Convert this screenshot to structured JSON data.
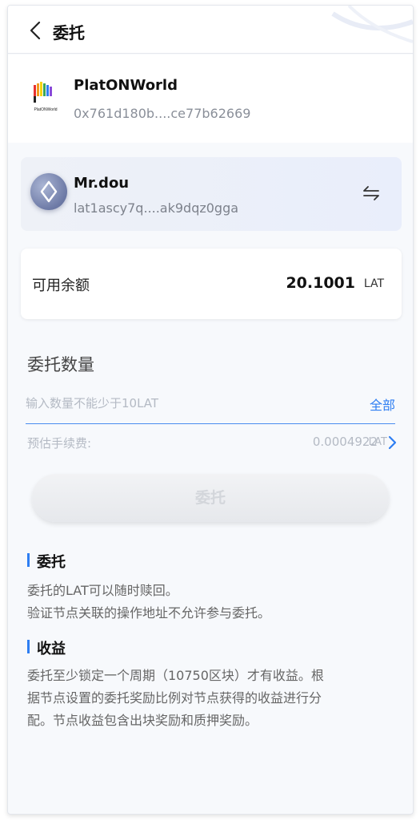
{
  "header": {
    "title": "委托",
    "back_icon": "chevron-left-icon"
  },
  "node": {
    "logo_text": "PlatONWorld",
    "name": "PlatONWorld",
    "address": "0x761d180b....ce77b62669"
  },
  "wallet": {
    "name": "Mr.dou",
    "address": "lat1ascy7q....ak9dqz0gga",
    "avatar_icon": "diamond-icon",
    "switch_icon": "swap-arrows-icon"
  },
  "balance": {
    "label": "可用余额",
    "value": "20.1001",
    "unit": "LAT"
  },
  "amount": {
    "title": "委托数量",
    "placeholder": "输入数量不能少于10LAT",
    "value": "",
    "all_label": "全部"
  },
  "fee": {
    "label": "预估手续费:",
    "value": "0.0004922",
    "unit": "LAT"
  },
  "delegate_button": {
    "label": "委托"
  },
  "info": {
    "delegation_heading": "委托",
    "delegation_lines": [
      "委托的LAT可以随时赎回。",
      "验证节点关联的操作地址不允许参与委托。"
    ],
    "earnings_heading": "收益",
    "earnings_lines": [
      "委托至少锁定一个周期（10750区块）才有收益。根",
      "据节点设置的委托奖励比例对节点获得的收益进行分",
      "配。节点收益包含出块奖励和质押奖励。"
    ]
  },
  "colors": {
    "accent": "#2e7ef2",
    "page_bg": "#f7f9fc",
    "muted_text": "#b4bac4"
  }
}
